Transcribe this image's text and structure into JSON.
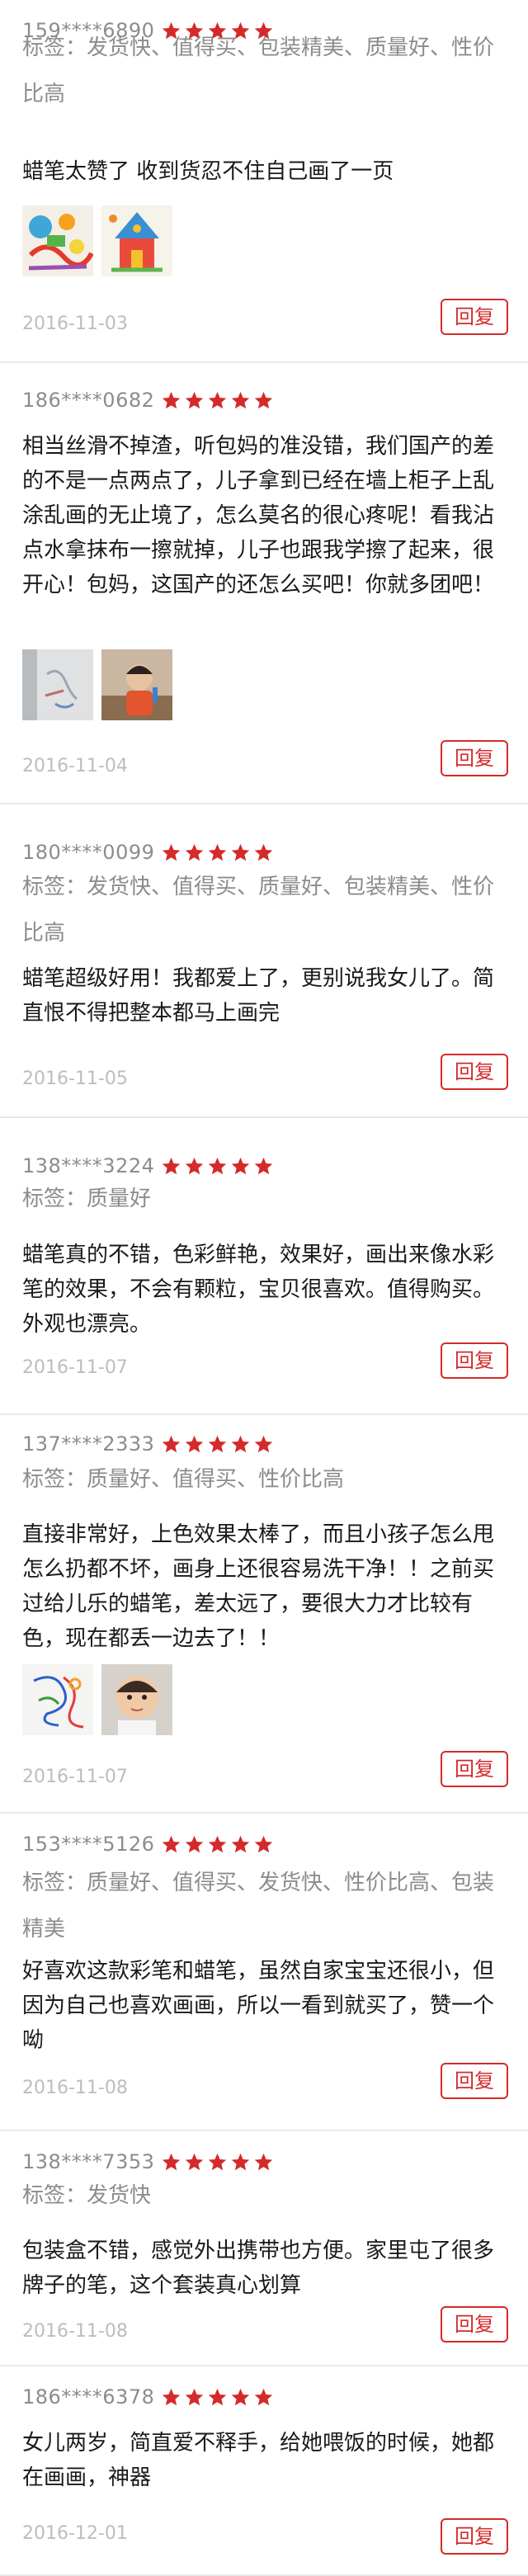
{
  "accent_color": "#d42a2a",
  "star_icon": "star-icon",
  "reply_label": "回复",
  "reviews": [
    {
      "user": "159****6890",
      "rating": 5,
      "tags": "标签：发货快、值得买、包装精美、质量好、性价比高",
      "text": "蜡笔太赞了 收到货忍不住自己画了一页",
      "photos": [
        "colored-drawing-photo",
        "colored-castle-drawing-photo"
      ],
      "date": "2016-11-03"
    },
    {
      "user": "186****0682",
      "rating": 5,
      "tags": "",
      "text": "相当丝滑不掉渣，听包妈的准没错，我们国产的差的不是一点两点了，儿子拿到已经在墙上柜子上乱涂乱画的无止境了，怎么莫名的很心疼呢！看我沾点水拿抹布一擦就掉，儿子也跟我学擦了起来，很开心！包妈，这国产的还怎么买吧！你就多团吧！",
      "photos": [
        "wall-scribble-photo",
        "child-photo"
      ],
      "date": "2016-11-04"
    },
    {
      "user": "180****0099",
      "rating": 5,
      "tags": "标签：发货快、值得买、质量好、包装精美、性价比高",
      "text": "蜡笔超级好用！我都爱上了，更别说我女儿了。简直恨不得把整本都马上画完",
      "photos": [],
      "date": "2016-11-05"
    },
    {
      "user": "138****3224",
      "rating": 5,
      "tags": "标签：质量好",
      "text": "蜡笔真的不错，色彩鲜艳，效果好，画出来像水彩笔的效果，不会有颗粒，宝贝很喜欢。值得购买。外观也漂亮。",
      "photos": [],
      "date": "2016-11-07"
    },
    {
      "user": "137****2333",
      "rating": 5,
      "tags": "标签：质量好、值得买、性价比高",
      "text": "直接非常好，上色效果太棒了，而且小孩子怎么甩怎么扔都不坏，画身上还很容易洗干净！！之前买过给儿乐的蜡笔，差太远了，要很大力才比较有色，现在都丢一边去了！！",
      "photos": [
        "scribble-paper-photo",
        "baby-photo"
      ],
      "date": "2016-11-07"
    },
    {
      "user": "153****5126",
      "rating": 5,
      "tags": "标签：质量好、值得买、发货快、性价比高、包装精美",
      "text": "好喜欢这款彩笔和蜡笔，虽然自家宝宝还很小，但因为自己也喜欢画画，所以一看到就买了，赞一个呦",
      "photos": [],
      "date": "2016-11-08"
    },
    {
      "user": "138****7353",
      "rating": 5,
      "tags": "标签：发货快",
      "text": "包装盒不错，感觉外出携带也方便。家里屯了很多牌子的笔，这个套装真心划算",
      "photos": [],
      "date": "2016-11-08"
    },
    {
      "user": "186****6378",
      "rating": 5,
      "tags": "",
      "text": "女儿两岁，简直爱不释手，给她喂饭的时候，她都在画画，神器",
      "photos": [],
      "date": "2016-12-01"
    }
  ]
}
